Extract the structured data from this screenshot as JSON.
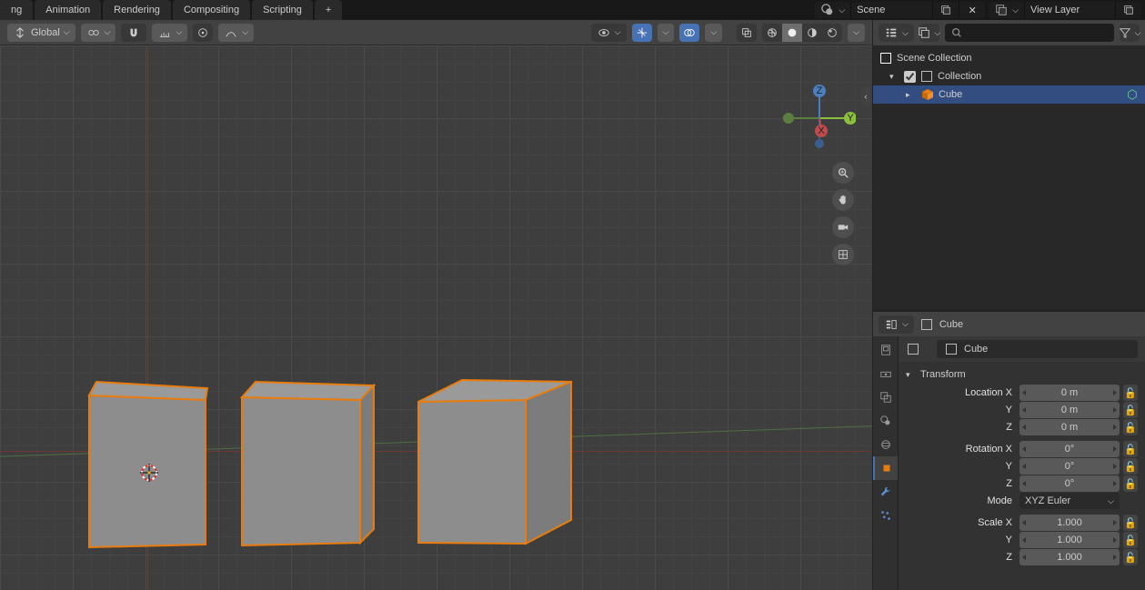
{
  "tabs": [
    "ng",
    "Animation",
    "Rendering",
    "Compositing",
    "Scripting"
  ],
  "sceneField": "Scene",
  "viewLayerField": "View Layer",
  "orientation": "Global",
  "outliner": {
    "root": "Scene Collection",
    "collection": "Collection",
    "item": "Cube"
  },
  "props": {
    "context": "Cube",
    "breadcrumb": "Cube",
    "transform": {
      "title": "Transform",
      "locLabel": "Location X",
      "rotLabel": "Rotation X",
      "sclLabel": "Scale X",
      "modeLabel": "Mode",
      "mode": "XYZ Euler",
      "loc": [
        "0 m",
        "0 m",
        "0 m"
      ],
      "rot": [
        "0°",
        "0°",
        "0°"
      ],
      "scl": [
        "1.000",
        "1.000",
        "1.000"
      ],
      "axes": [
        "Y",
        "Z"
      ]
    }
  },
  "search_placeholder": ""
}
